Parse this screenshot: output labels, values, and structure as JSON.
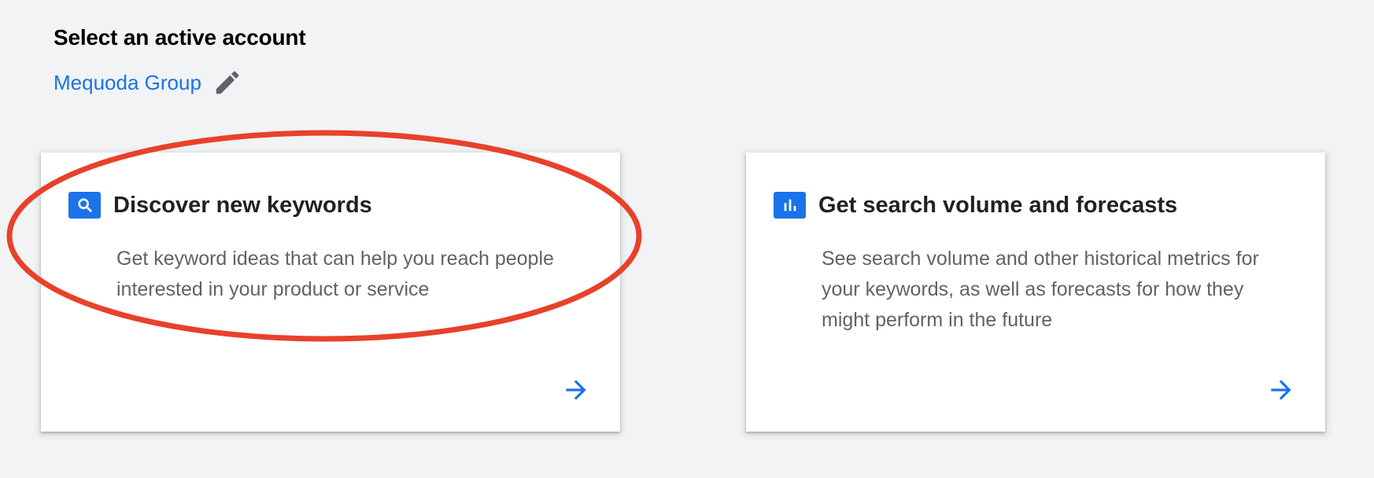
{
  "header": {
    "title": "Select an active account",
    "account_name": "Mequoda Group",
    "edit_icon": "pencil-icon"
  },
  "cards": [
    {
      "icon": "search-icon",
      "title": "Discover new keywords",
      "description": "Get keyword ideas that can help you reach people interested in your product or service",
      "arrow_icon": "arrow-right-icon"
    },
    {
      "icon": "bar-chart-icon",
      "title": "Get search volume and forecasts",
      "description": "See search volume and other historical metrics for your keywords, as well as forecasts for how they might perform in the future",
      "arrow_icon": "arrow-right-icon"
    }
  ],
  "annotation": {
    "shape": "ellipse",
    "color": "#e8412b",
    "target": "Discover new keywords card"
  },
  "colors": {
    "background": "#f1f3f4",
    "accent": "#1a73e8",
    "title_text": "#202124",
    "body_text": "#5f6368",
    "icon_gray": "#5f6368"
  }
}
